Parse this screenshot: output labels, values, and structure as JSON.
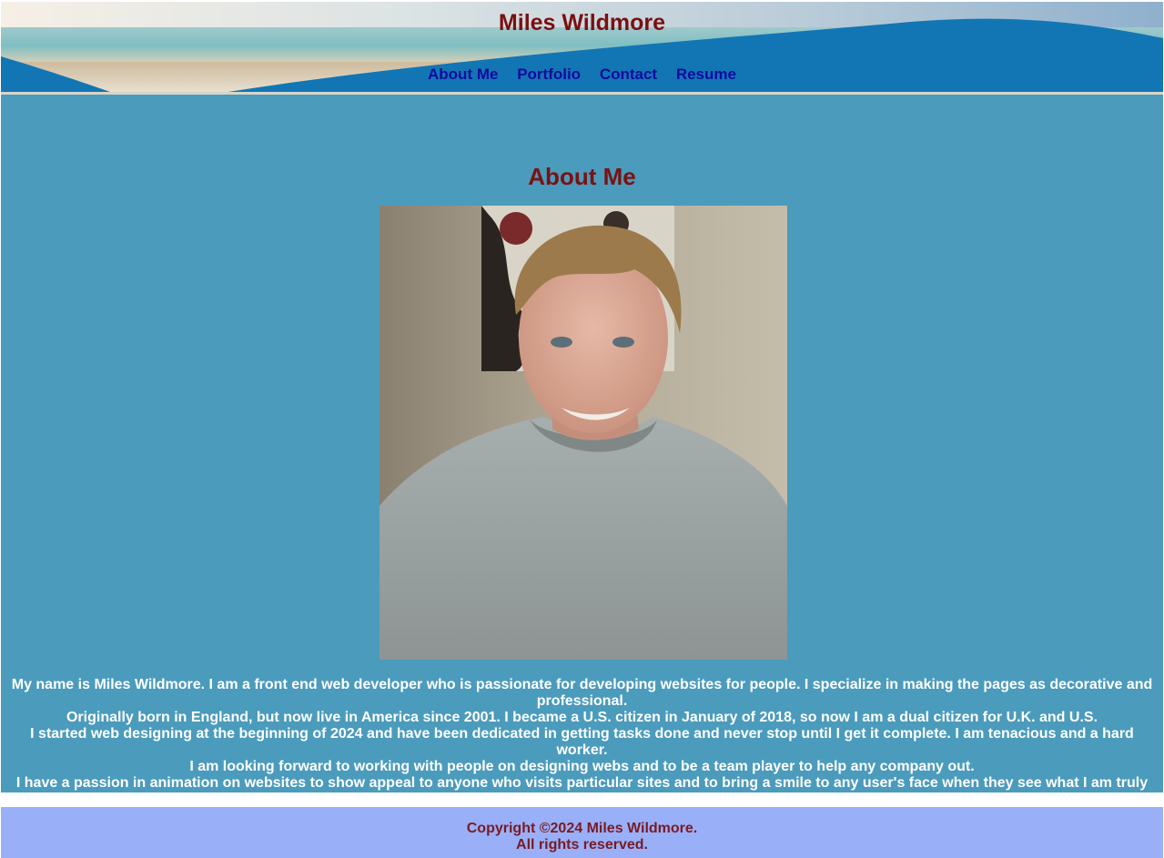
{
  "header": {
    "title": "Miles Wildmore",
    "nav": [
      "About Me",
      "Portfolio",
      "Contact",
      "Resume"
    ]
  },
  "main": {
    "heading": "About Me",
    "bio": [
      "My name is Miles Wildmore. I am a front end web developer who is passionate for developing websites for people. I specialize in making the pages as decorative and professional.",
      "Originally born in England, but now live in America since 2001. I became a U.S. citizen in January of 2018, so now I am a dual citizen for U.K. and U.S.",
      "I started web designing at the beginning of 2024 and have been dedicated in getting tasks done and never stop until I get it complete. I am tenacious and a hard worker.",
      "I am looking forward to working with people on designing webs and to be a team player to help any company out.",
      "I have a passion in animation on websites to show appeal to anyone who visits particular sites and to bring a smile to any user's face when they see what I am truly capable of."
    ]
  },
  "footer": {
    "copyright": "Copyright ©2024 Miles Wildmore.",
    "rights": "All rights reserved."
  },
  "colors": {
    "title": "#7a0f10",
    "nav_link": "#100a9f",
    "main_bg": "#4b9bbc",
    "footer_bg": "#99b0f9",
    "wave_blue": "#1276b4"
  }
}
